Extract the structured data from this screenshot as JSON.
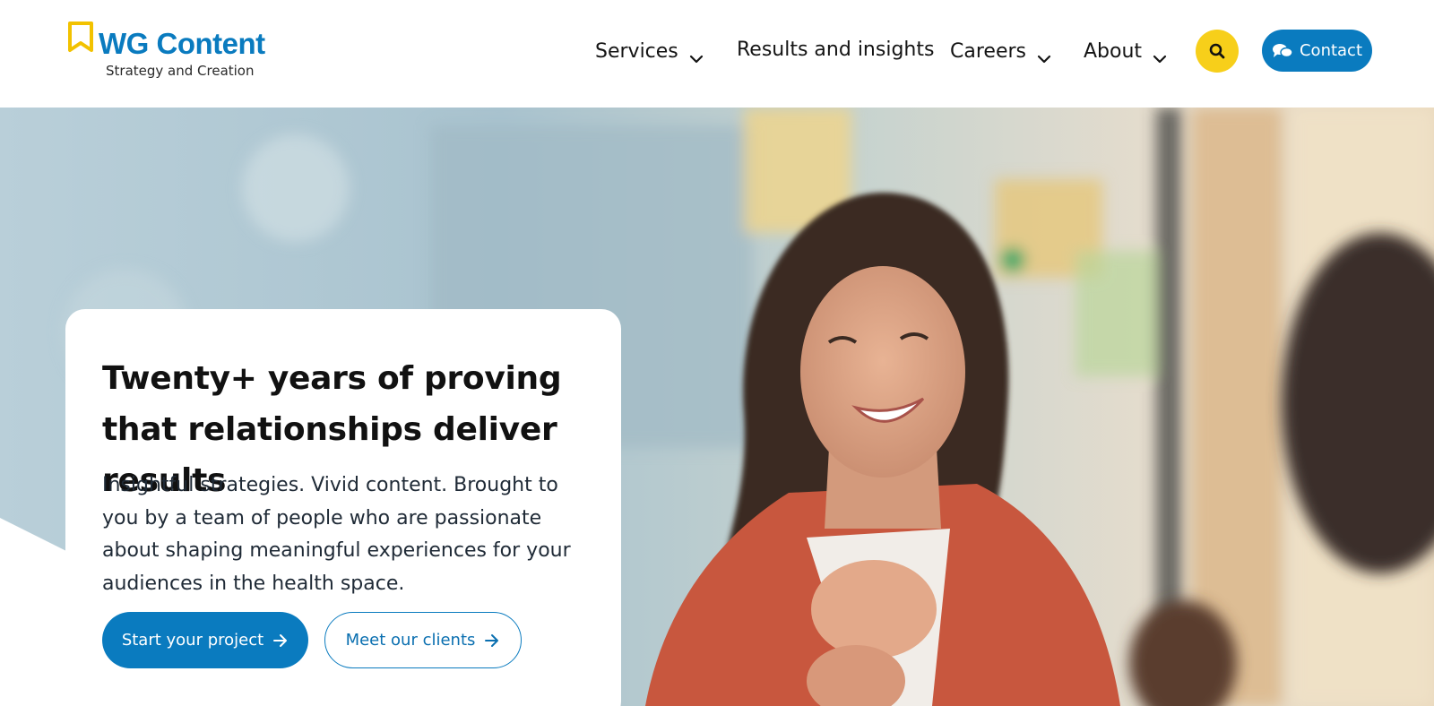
{
  "brand": {
    "name": "WG Content",
    "tagline": "Strategy and Creation",
    "logo_icon": "pencil-flag-icon"
  },
  "nav": {
    "items": [
      {
        "label": "Services",
        "has_dropdown": true
      },
      {
        "label": "Results and insights",
        "has_dropdown": false
      },
      {
        "label": "Careers",
        "has_dropdown": true
      },
      {
        "label": "About",
        "has_dropdown": true
      }
    ],
    "search_icon": "search-icon",
    "contact_label": "Contact",
    "contact_icon": "chat-bubbles-icon"
  },
  "hero": {
    "headline": "Twenty+ years of proving that relationships deliver results",
    "lede": "Insightful strategies. Vivid content. Brought to you by a team of people who are passionate about shaping meaningful experiences for your audiences in the health space.",
    "primary_cta": "Start your project",
    "secondary_cta": "Meet our clients",
    "image_subject": "smiling-woman-photo"
  },
  "colors": {
    "brand_blue": "#0a7bbf",
    "accent_yellow": "#f7cf1a",
    "text_dark": "#111111"
  }
}
